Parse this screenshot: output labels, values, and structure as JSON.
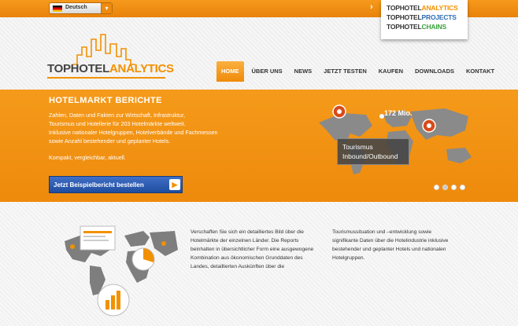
{
  "topbar": {
    "language": "Deutsch",
    "chevron": "›"
  },
  "brands": [
    {
      "prefix": "TOPHOTEL",
      "suffix": "ANALYTICS",
      "color": "#f29100"
    },
    {
      "prefix": "TOPHOTEL",
      "suffix": "PROJECTS",
      "color": "#2e6db4"
    },
    {
      "prefix": "TOPHOTEL",
      "suffix": "CHAINS",
      "color": "#3aa03a"
    }
  ],
  "logo": {
    "part1": "TOPHOTEL",
    "part2": "ANALYTICS"
  },
  "nav": [
    "HOME",
    "ÜBER UNS",
    "NEWS",
    "JETZT TESTEN",
    "KAUFEN",
    "DOWNLOADS",
    "KONTAKT"
  ],
  "hero": {
    "title": "HOTELMARKT BERICHTE",
    "lines": [
      "Zahlen, Daten und Fakten zur Wirtschaft, Infrastruktur,",
      "Tourismus und Hotellerie für 203 Hotelmärkte weltweit.",
      "Inklusive nationaler Hotelgruppen, Hotelverbände und Fachmessen",
      "sowie Anzahl bestehender und geplanter Hotels."
    ],
    "tagline": "Kompakt, vergleichbar, aktuell.",
    "cta_label": "Jetzt Beispielbericht bestellen",
    "stat": "172 Mio.",
    "tour_line1": "Tourismus",
    "tour_line2": "Inbound/Outbound"
  },
  "content": {
    "col1_lines": [
      "Verschaffen Sie sich ein detailliertes Bild über die",
      "Hotelmärkte der einzelnen Länder. Die Reports",
      "beinhalten in übersichtlicher Form eine ausgewogene",
      "Kombination aus ökonomischen Grunddaten des",
      "Landes, detaillierten Auskünften über die"
    ],
    "col2_lines": [
      "Tourismussituation und –entwicklung sowie",
      "signifikante Daten über die Hotelindustrie inklusive",
      "bestehender und geplanter Hotels und nationalen",
      "Hotelgruppen."
    ]
  },
  "colors": {
    "orange": "#f29100",
    "blue": "#2b5cb0"
  }
}
